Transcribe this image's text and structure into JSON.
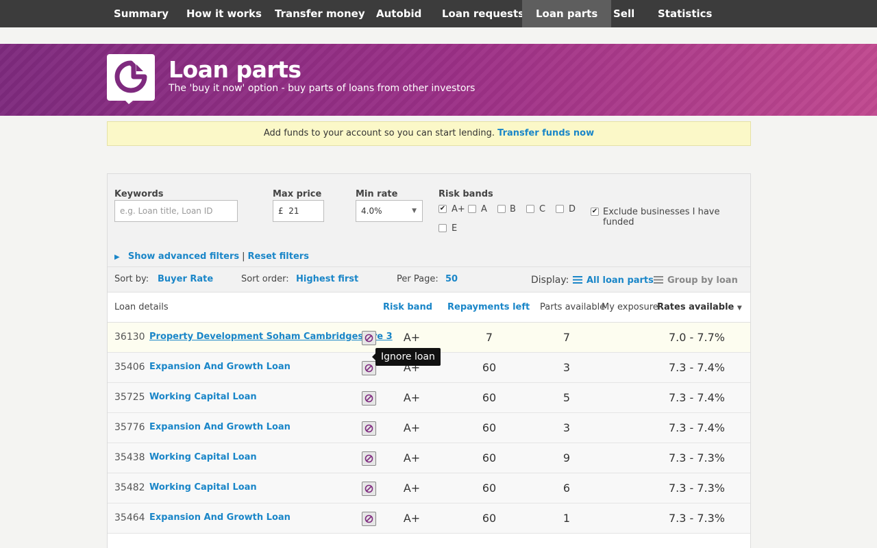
{
  "nav": {
    "items": [
      "Summary",
      "How it works",
      "Transfer money",
      "Autobid",
      "Loan requests",
      "Loan parts",
      "Sell",
      "Statistics"
    ],
    "active": "Loan parts"
  },
  "hero": {
    "title": "Loan parts",
    "subtitle": "The 'buy it now' option - buy parts of loans from other investors"
  },
  "notice": {
    "text": "Add funds to your account so you can start lending.",
    "link": "Transfer funds now"
  },
  "filters": {
    "keywords_label": "Keywords",
    "keywords_placeholder": "e.g. Loan title, Loan ID",
    "max_price_label": "Max price",
    "max_price_currency": "£",
    "max_price_value": "21",
    "min_rate_label": "Min rate",
    "min_rate_value": "4.0%",
    "risk_bands_label": "Risk bands",
    "risk_bands": [
      {
        "label": "A+",
        "checked": true
      },
      {
        "label": "A",
        "checked": false
      },
      {
        "label": "B",
        "checked": false
      },
      {
        "label": "C",
        "checked": false
      },
      {
        "label": "D",
        "checked": false
      },
      {
        "label": "E",
        "checked": false
      }
    ],
    "exclude_label": "Exclude businesses I have funded",
    "exclude_checked": true,
    "advanced_link": "Show advanced filters",
    "reset_link": "Reset filters"
  },
  "sortbar": {
    "sort_by_label": "Sort by:",
    "sort_by_value": "Buyer Rate",
    "sort_order_label": "Sort order:",
    "sort_order_value": "Highest first",
    "per_page_label": "Per Page:",
    "per_page_value": "50",
    "display_label": "Display:",
    "display_all": "All loan parts",
    "display_group": "Group by loan"
  },
  "table": {
    "headers": {
      "loan_details": "Loan details",
      "risk_band": "Risk band",
      "repayments_left": "Repayments left",
      "parts_available": "Parts available",
      "my_exposure": "My exposure",
      "rates_available": "Rates available"
    },
    "sort_indicator": "▼",
    "rows": [
      {
        "id": "36130",
        "title": "Property Development Soham Cambridgeshire 3",
        "band": "A+",
        "repayments": "7",
        "parts": "7",
        "rates": "7.0 - 7.7%"
      },
      {
        "id": "35406",
        "title": "Expansion And Growth Loan",
        "band": "A+",
        "repayments": "60",
        "parts": "3",
        "rates": "7.3 - 7.4%"
      },
      {
        "id": "35725",
        "title": "Working Capital Loan",
        "band": "A+",
        "repayments": "60",
        "parts": "5",
        "rates": "7.3 - 7.4%"
      },
      {
        "id": "35776",
        "title": "Expansion And Growth Loan",
        "band": "A+",
        "repayments": "60",
        "parts": "3",
        "rates": "7.3 - 7.4%"
      },
      {
        "id": "35438",
        "title": "Working Capital Loan",
        "band": "A+",
        "repayments": "60",
        "parts": "9",
        "rates": "7.3 - 7.3%"
      },
      {
        "id": "35482",
        "title": "Working Capital Loan",
        "band": "A+",
        "repayments": "60",
        "parts": "6",
        "rates": "7.3 - 7.3%"
      },
      {
        "id": "35464",
        "title": "Expansion And Growth Loan",
        "band": "A+",
        "repayments": "60",
        "parts": "1",
        "rates": "7.3 - 7.3%"
      }
    ]
  },
  "tooltip": "Ignore loan",
  "colors": {
    "link": "#1a86c8",
    "nav_bg": "#3c3c3c",
    "hero": "#9a2f86",
    "notice_bg": "#fbf8c8"
  }
}
